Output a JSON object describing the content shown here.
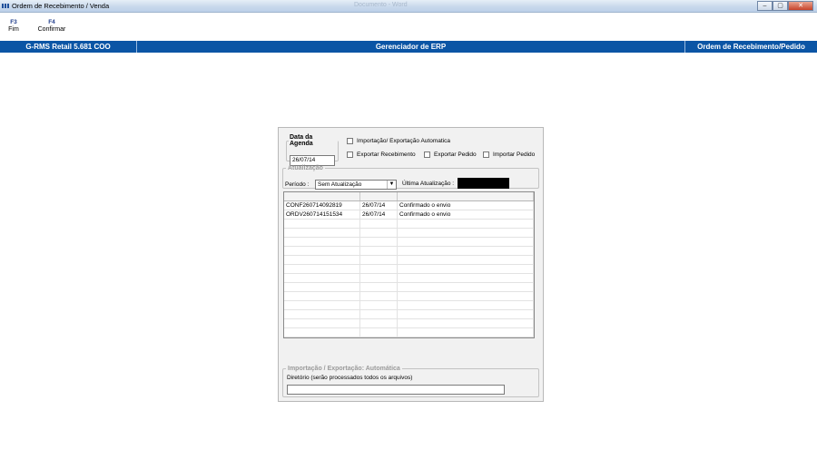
{
  "window": {
    "title": "Ordem de Recebimento / Venda",
    "center_title": "Documento - Word",
    "controls": {
      "minimize": "–",
      "maximize": "▢",
      "close": "✕"
    }
  },
  "toolbar": {
    "buttons": [
      {
        "key": "F3",
        "label": "Fim"
      },
      {
        "key": "F4",
        "label": "Confirmar"
      }
    ]
  },
  "header": {
    "left": "G-RMS Retail 5.681 COO",
    "center": "Gerenciador de ERP",
    "right": "Ordem de Recebimento/Pedido"
  },
  "panel": {
    "agenda": {
      "legend": "Data da Agenda",
      "date": "26/07/14"
    },
    "checkboxes": {
      "auto": "Importação/ Exportação Automatica",
      "exportar_recebimento": "Exportar Recebimento",
      "exportar_pedido": "Exportar Pedido",
      "importar_pedido": "Importar Pedido"
    },
    "atualizacao": {
      "legend": "Atualização",
      "periodo_label": "Período :",
      "periodo_value": "Sem Atualização",
      "ultima_label": "Última Atualização :"
    },
    "grid": {
      "headers": [
        "",
        "",
        ""
      ],
      "rows": [
        [
          "CONF260714092819",
          "26/07/14",
          "Confirmado o envio"
        ],
        [
          "ORDV260714151534",
          "26/07/14",
          "Confirmado o envio"
        ]
      ]
    },
    "importacao": {
      "legend": "Importação / Exportação: Automática",
      "dir_label": "Diretório (serão processados todos os arquivos)",
      "dir_value": ""
    }
  }
}
